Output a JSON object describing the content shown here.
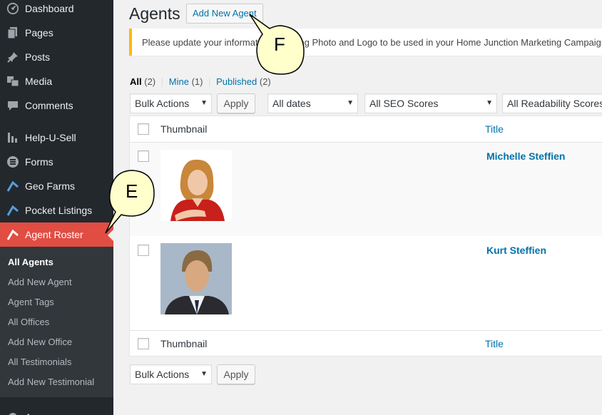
{
  "sidebar": {
    "items": [
      {
        "label": "Dashboard",
        "icon": "dashboard-icon"
      },
      {
        "label": "Pages",
        "icon": "pages-icon"
      },
      {
        "label": "Posts",
        "icon": "pin-icon"
      },
      {
        "label": "Media",
        "icon": "media-icon"
      },
      {
        "label": "Comments",
        "icon": "comment-icon"
      },
      {
        "label": "Help-U-Sell",
        "icon": "chart-icon"
      },
      {
        "label": "Forms",
        "icon": "forms-icon"
      },
      {
        "label": "Geo Farms",
        "icon": "roof-icon"
      },
      {
        "label": "Pocket Listings",
        "icon": "roof-icon"
      },
      {
        "label": "Agent Roster",
        "icon": "roof-icon"
      }
    ],
    "submenu": [
      "All Agents",
      "Add New Agent",
      "Agent Tags",
      "All Offices",
      "Add New Office",
      "All Testimonials",
      "Add New Testimonial"
    ],
    "bottom_label": "A"
  },
  "header": {
    "title": "Agents",
    "add_new": "Add New Agent"
  },
  "notice": {
    "text": "Please update your information including Photo and Logo to be used in your Home Junction Marketing Campaign"
  },
  "filters": {
    "all": "All",
    "all_count": "(2)",
    "mine": "Mine",
    "mine_count": "(1)",
    "published": "Published",
    "published_count": "(2)"
  },
  "toolbar": {
    "bulk_actions": "Bulk Actions",
    "apply": "Apply",
    "dates": "All dates",
    "seo": "All SEO Scores",
    "readability": "All Readability Scores"
  },
  "table": {
    "col_thumbnail": "Thumbnail",
    "col_title": "Title",
    "rows": [
      {
        "title": "Michelle Steffien"
      },
      {
        "title": "Kurt Steffien"
      }
    ]
  },
  "callouts": {
    "e": "E",
    "f": "F"
  },
  "colors": {
    "sidebar_bg": "#23282d",
    "submenu_bg": "#32373c",
    "active": "#e14d43",
    "link": "#0073aa",
    "notice_border": "#ffb900",
    "callout_fill": "#ffffcc"
  }
}
